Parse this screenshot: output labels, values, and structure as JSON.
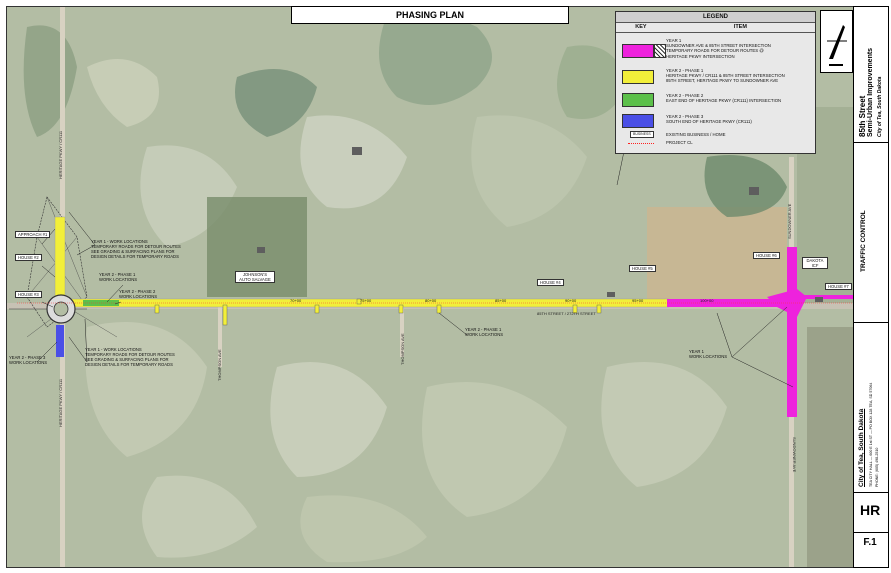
{
  "title": "PHASING PLAN",
  "legend": {
    "header": "LEGEND",
    "col_key": "KEY",
    "col_item": "ITEM",
    "colors": {
      "year1": "#ee22dd",
      "phase1": "#f2ef3a",
      "phase2": "#5cc04a",
      "phase3": "#4a4fe6"
    },
    "year1_title": "YEAR 1",
    "year1_items": [
      "SUNDOWNER AVE & 85TH STREET INTERSECTION",
      "TEMPORARY ROADS FOR DETOUR ROUTES @",
      "HERITAGE PKWY INTERSECTION"
    ],
    "phase1_title": "YEAR 2 - PHASE 1",
    "phase1_items": [
      "HERITAGE PKWY / CR111 & 85TH STREET INTERSECTION",
      "85TH STREET, HERITAGE PKWY TO SUNDOWNER AVE"
    ],
    "phase2_title": "YEAR 2 - PHASE 2",
    "phase2_items": [
      "EAST END OF HERITAGE PKWY (CR111) INTERSECTION"
    ],
    "phase3_title": "YEAR 2 - PHASE 3",
    "phase3_items": [
      "SOUTH END OF HERITAGE PKWY (CR111)"
    ],
    "business_key": "BUSINESS",
    "business_item": "EXISTING BUSINESS / HOME",
    "project_cl": "PROJECT CL"
  },
  "labels": {
    "approach": "APPROACH #1",
    "house1": "HOUSE #1",
    "house2": "HOUSE #2",
    "house3": "HOUSE #3",
    "house4": "HOUSE #4",
    "house5": "HOUSE #5",
    "house6": "HOUSE #6",
    "house7": "HOUSE #7",
    "dakota": "DAKOTA ICF",
    "johnsons": "JOHNSON'S AUTO SALVAGE",
    "y1_work_top": "YEAR 1 - WORK LOCATIONS",
    "temp_roads": "TEMPORARY ROADS FOR DETOUR ROUTES",
    "see_grading": "SEE GRADING & SURFACING PLANS FOR",
    "design_details": "DESIGN DETAILS FOR TEMPORARY ROADS",
    "y2p1_work": "YEAR 2 - PHASE 1",
    "work_locations": "WORK LOCATIONS",
    "y2p2_work": "YEAR 2 - PHASE 2",
    "y2p3_work": "YEAR 2 - PHASE 3",
    "y1_work_bottom": "YEAR 1 - WORK LOCATIONS",
    "y1_east": "YEAR 1",
    "heritage_pkwy": "HERITAGE PKWY / CR111",
    "street_85": "85TH STREET / 272TH STREET",
    "thompson": "THOMPSON AVE",
    "sundowner": "SUNDOWNER AVE",
    "stations": [
      "70+00",
      "75+00",
      "80+00",
      "85+00",
      "90+00",
      "95+00",
      "100+00"
    ]
  },
  "titleblock": {
    "project_line1": "85th Street",
    "project_line2": "Semi-Urban Improvements",
    "project_line3": "City of Tea, South Dakota",
    "section": "TRAFFIC CONTROL",
    "client": "City of Tea, South Dakota",
    "client_addr": "TEA CITY HALL — 600 E 1st ST — PO BOX 128 TEA, SD 57064",
    "client_phone": "PHONE: (605) 498-2510",
    "firm": "HR",
    "sheet_no": "F.1"
  }
}
